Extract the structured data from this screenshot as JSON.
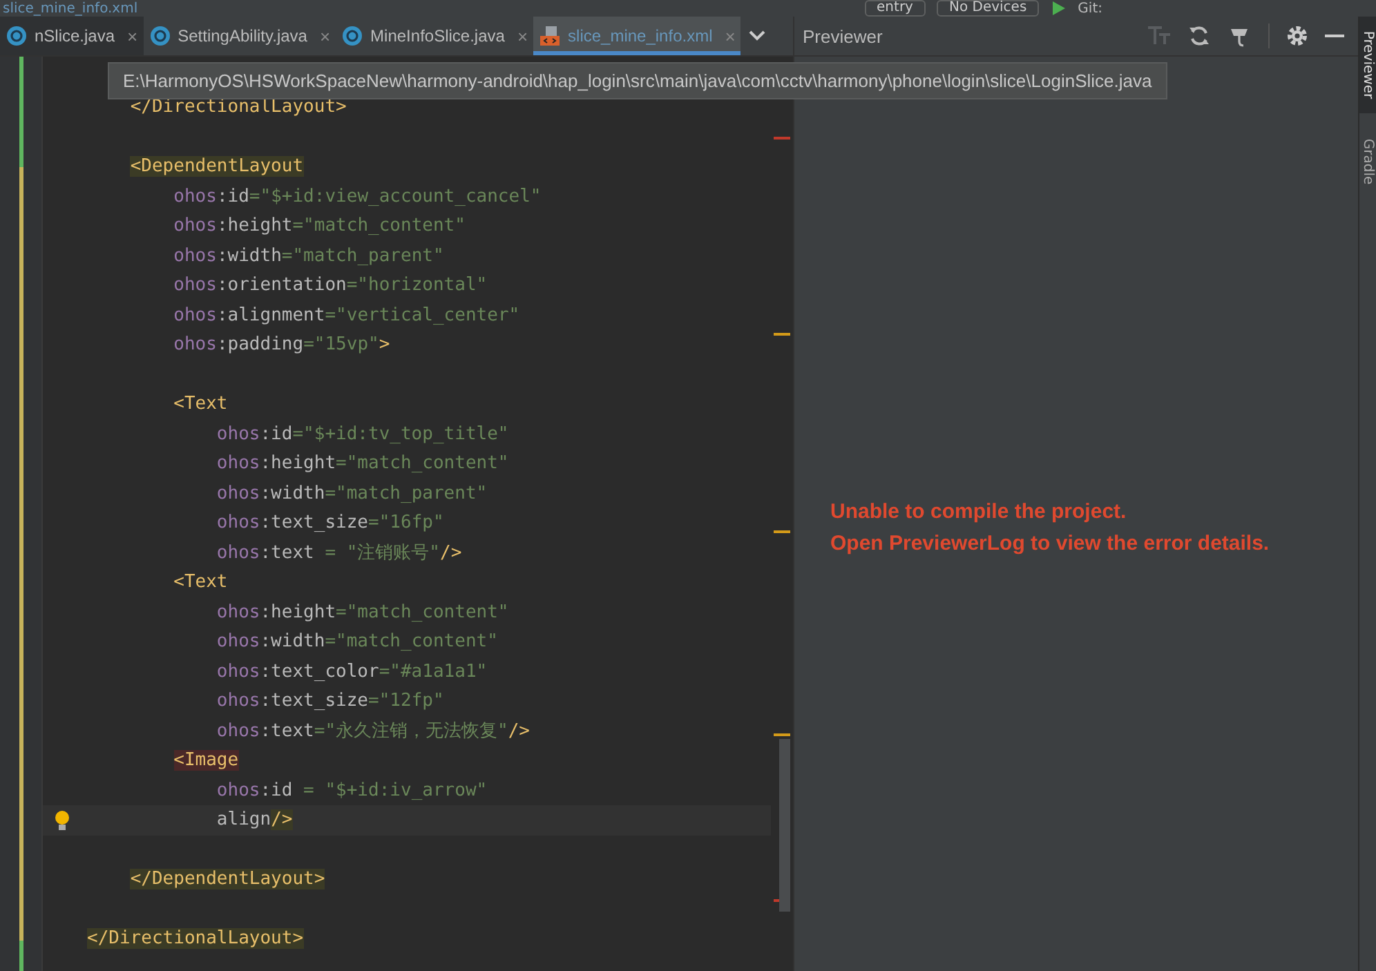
{
  "toolbar": {
    "window_title": "slice_mine_info.xml",
    "run_config": "entry",
    "device": "No Devices",
    "vcs_label": "Git:"
  },
  "tabs": [
    {
      "label": "nSlice.java",
      "kind": "class",
      "close": "×",
      "selected": false
    },
    {
      "label": "SettingAbility.java",
      "kind": "class",
      "close": "×",
      "selected": false
    },
    {
      "label": "MineInfoSlice.java",
      "kind": "class",
      "close": "×",
      "selected": false
    },
    {
      "label": "slice_mine_info.xml",
      "kind": "xml",
      "close": "×",
      "selected": true
    }
  ],
  "tooltip": "E:\\HarmonyOS\\HSWorkSpaceNew\\harmony-android\\hap_login\\src\\main\\java\\com\\cctv\\harmony\\phone\\login\\slice\\LoginSlice.java",
  "code_lines": [
    {
      "current": false,
      "tokens": [
        {
          "kind": "tag",
          "text": "    </DirectionalLayout>"
        }
      ]
    },
    {
      "current": false
    },
    {
      "current": false,
      "tokens": [
        {
          "kind": "tag-match",
          "text": "    <DependentLayout"
        }
      ]
    },
    {
      "current": false,
      "tokens": [
        {
          "kind": "ns",
          "text": "        ohos"
        },
        {
          "kind": "attr",
          "text": ":id"
        },
        {
          "kind": "string",
          "text": "=\"$+id:view_account_cancel\""
        }
      ]
    },
    {
      "current": false,
      "tokens": [
        {
          "kind": "ns",
          "text": "        ohos"
        },
        {
          "kind": "attr",
          "text": ":height"
        },
        {
          "kind": "string",
          "text": "=\"match_content\""
        }
      ]
    },
    {
      "current": false,
      "tokens": [
        {
          "kind": "ns",
          "text": "        ohos"
        },
        {
          "kind": "attr",
          "text": ":width"
        },
        {
          "kind": "string",
          "text": "=\"match_parent\""
        }
      ]
    },
    {
      "current": false,
      "tokens": [
        {
          "kind": "ns",
          "text": "        ohos"
        },
        {
          "kind": "attr",
          "text": ":orientation"
        },
        {
          "kind": "string",
          "text": "=\"horizontal\""
        }
      ]
    },
    {
      "current": false,
      "tokens": [
        {
          "kind": "ns",
          "text": "        ohos"
        },
        {
          "kind": "attr",
          "text": ":alignment"
        },
        {
          "kind": "string",
          "text": "=\"vertical_center\""
        }
      ]
    },
    {
      "current": false,
      "tokens": [
        {
          "kind": "ns",
          "text": "        ohos"
        },
        {
          "kind": "attr",
          "text": ":padding"
        },
        {
          "kind": "string",
          "text": "=\"15vp\""
        },
        {
          "kind": "tag",
          "text": ">"
        }
      ]
    },
    {
      "current": false
    },
    {
      "current": false,
      "tokens": [
        {
          "kind": "tag",
          "text": "        <Text"
        }
      ]
    },
    {
      "current": false,
      "tokens": [
        {
          "kind": "ns",
          "text": "            ohos"
        },
        {
          "kind": "attr",
          "text": ":id"
        },
        {
          "kind": "string",
          "text": "=\"$+id:tv_top_title\""
        }
      ]
    },
    {
      "current": false,
      "tokens": [
        {
          "kind": "ns",
          "text": "            ohos"
        },
        {
          "kind": "attr",
          "text": ":height"
        },
        {
          "kind": "string",
          "text": "=\"match_content\""
        }
      ]
    },
    {
      "current": false,
      "tokens": [
        {
          "kind": "ns",
          "text": "            ohos"
        },
        {
          "kind": "attr",
          "text": ":width"
        },
        {
          "kind": "string",
          "text": "=\"match_parent\""
        }
      ]
    },
    {
      "current": false,
      "tokens": [
        {
          "kind": "ns",
          "text": "            ohos"
        },
        {
          "kind": "attr",
          "text": ":text_size"
        },
        {
          "kind": "string",
          "text": "=\"16fp\""
        }
      ]
    },
    {
      "current": false,
      "tokens": [
        {
          "kind": "ns",
          "text": "            ohos"
        },
        {
          "kind": "attr",
          "text": ":text"
        },
        {
          "kind": "string",
          "text": " = \"注销账号\""
        },
        {
          "kind": "tag",
          "text": "/>"
        }
      ]
    },
    {
      "current": false,
      "tokens": [
        {
          "kind": "tag",
          "text": "        <Text"
        }
      ]
    },
    {
      "current": false,
      "tokens": [
        {
          "kind": "ns",
          "text": "            ohos"
        },
        {
          "kind": "attr",
          "text": ":height"
        },
        {
          "kind": "string",
          "text": "=\"match_content\""
        }
      ]
    },
    {
      "current": false,
      "tokens": [
        {
          "kind": "ns",
          "text": "            ohos"
        },
        {
          "kind": "attr",
          "text": ":width"
        },
        {
          "kind": "string",
          "text": "=\"match_content\""
        }
      ]
    },
    {
      "current": false,
      "tokens": [
        {
          "kind": "ns",
          "text": "            ohos"
        },
        {
          "kind": "attr",
          "text": ":text_color"
        },
        {
          "kind": "string",
          "text": "=\"#a1a1a1\""
        }
      ]
    },
    {
      "current": false,
      "tokens": [
        {
          "kind": "ns",
          "text": "            ohos"
        },
        {
          "kind": "attr",
          "text": ":text_size"
        },
        {
          "kind": "string",
          "text": "=\"12fp\""
        }
      ]
    },
    {
      "current": false,
      "tokens": [
        {
          "kind": "ns",
          "text": "            ohos"
        },
        {
          "kind": "attr",
          "text": ":text"
        },
        {
          "kind": "string",
          "text": "=\"永久注销，无法恢复\""
        },
        {
          "kind": "tag",
          "text": "/>"
        }
      ]
    },
    {
      "current": false,
      "tokens": [
        {
          "kind": "tag-error",
          "text": "        <Image"
        }
      ]
    },
    {
      "current": false,
      "tokens": [
        {
          "kind": "ns",
          "text": "            ohos"
        },
        {
          "kind": "attr",
          "text": ":id"
        },
        {
          "kind": "string",
          "text": " = \"$+id:iv_arrow\""
        }
      ]
    },
    {
      "current": true,
      "tokens": [
        {
          "kind": "attr",
          "text": "            align"
        },
        {
          "kind": "tag-match",
          "text": "/>"
        }
      ]
    },
    {
      "current": false
    },
    {
      "current": false,
      "tokens": [
        {
          "kind": "tag-match",
          "text": "    </DependentLayout>"
        }
      ]
    },
    {
      "current": false
    },
    {
      "current": false,
      "tokens": [
        {
          "kind": "tag-match",
          "text": "</DirectionalLayout>"
        }
      ]
    }
  ],
  "previewer": {
    "title": "Previewer",
    "messages": [
      "Unable to compile the project.",
      "Open PreviewerLog to view the error details."
    ]
  },
  "side_tabs": [
    {
      "label": "Previewer",
      "selected": true
    },
    {
      "label": "Gradle",
      "selected": false
    }
  ]
}
